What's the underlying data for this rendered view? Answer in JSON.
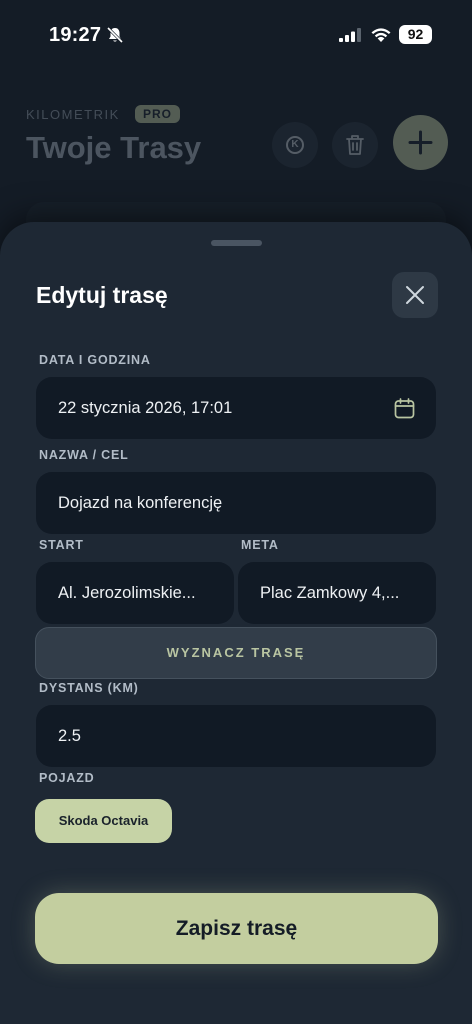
{
  "status_bar": {
    "time": "19:27",
    "battery": "92"
  },
  "background": {
    "brand": "KILOMETRIK",
    "badge": "PRO",
    "title": "Twoje Trasy",
    "k_label": "K"
  },
  "sheet": {
    "title": "Edytuj trasę",
    "date": {
      "label": "DATA I GODZINA",
      "value": "22 stycznia 2026, 17:01"
    },
    "name": {
      "label": "NAZWA / CEL",
      "value": "Dojazd na konferencję"
    },
    "start": {
      "label": "START",
      "value": "Al. Jerozolimskie..."
    },
    "meta": {
      "label": "META",
      "value": "Plac Zamkowy 4,..."
    },
    "route_button": "WYZNACZ TRASĘ",
    "distance": {
      "label": "DYSTANS (KM)",
      "value": "2.5"
    },
    "vehicle": {
      "label": "POJAZD",
      "selected": "Skoda Octavia"
    },
    "save_button": "Zapisz trasę"
  },
  "colors": {
    "accent": "#c3ce9f",
    "sheet_bg": "#1e2834",
    "field_bg": "#111a25"
  },
  "icons": [
    "bell-slash-icon",
    "signal-icon",
    "wifi-icon",
    "trash-icon",
    "plus-icon",
    "close-icon",
    "calendar-icon"
  ]
}
